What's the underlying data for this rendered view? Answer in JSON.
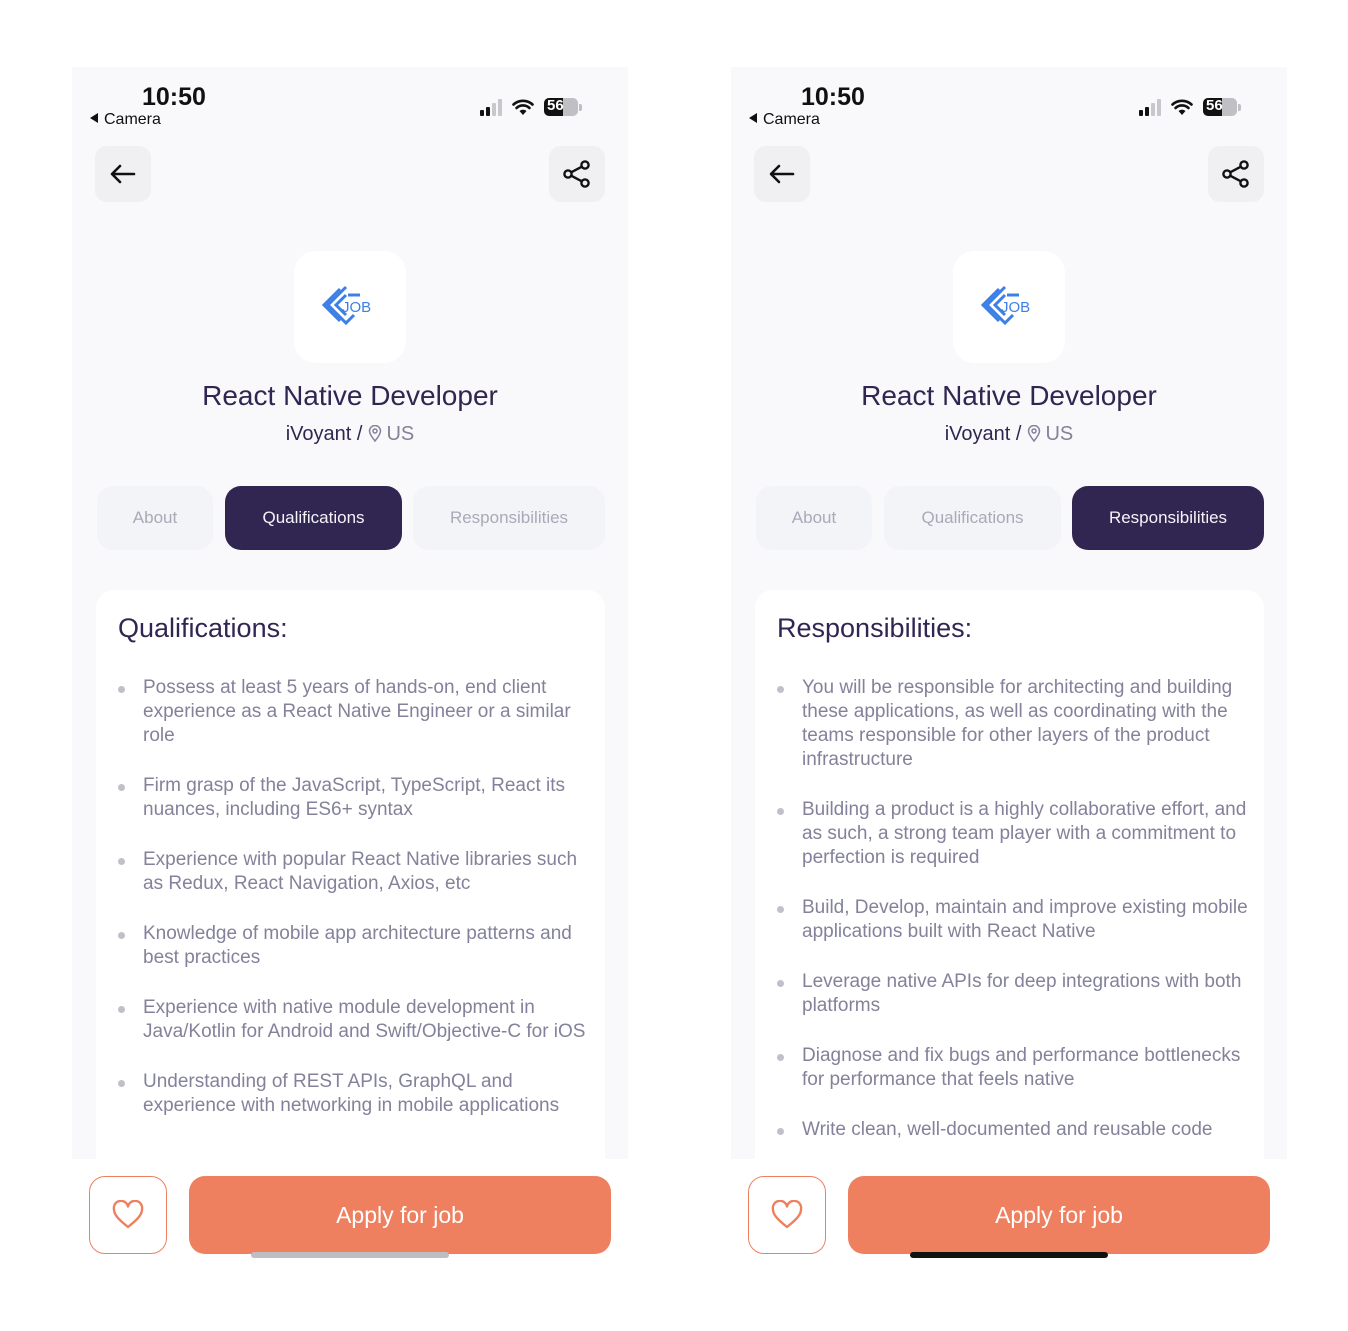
{
  "status_bar": {
    "time": "10:50",
    "back_app": "Camera",
    "battery": "56"
  },
  "job": {
    "title": "React Native Developer",
    "company": "iVoyant /",
    "location": "US",
    "logo_text": "JOB"
  },
  "tabs": [
    "About",
    "Qualifications",
    "Responsibilities"
  ],
  "left_screen": {
    "active_tab": "Qualifications",
    "section_title": "Qualifications:",
    "items": [
      "Possess at least 5 years of hands-on, end client experience as a React Native Engineer or a similar role",
      "Firm grasp of the JavaScript, TypeScript, React its nuances, including ES6+ syntax",
      "Experience with popular React Native libraries such as Redux, React Navigation, Axios, etc",
      "Knowledge of mobile app architecture patterns and best practices",
      "Experience with native module development in Java/Kotlin for Android and Swift/Objective-C for iOS",
      "Understanding of REST APIs, GraphQL and experience with networking in mobile applications"
    ]
  },
  "right_screen": {
    "active_tab": "Responsibilities",
    "section_title": "Responsibilities:",
    "items": [
      "You will be responsible for architecting and building these applications, as well as coordinating with the teams responsible for other layers of the product infrastructure",
      "Building a product is a highly collaborative effort, and as such, a strong team player with a commitment to perfection is required",
      "Build, Develop, maintain and improve existing mobile applications built with React Native",
      "Leverage native APIs for deep integrations with both platforms",
      "Diagnose and fix bugs and performance bottlenecks for performance that feels native",
      "Write clean, well-documented and reusable code"
    ]
  },
  "footer": {
    "apply_label": "Apply for job"
  },
  "icons": [
    "back-arrow-icon",
    "share-icon",
    "heart-icon",
    "location-pin-icon",
    "job-logo-icon",
    "signal-icon",
    "wifi-icon",
    "battery-icon"
  ],
  "colors": {
    "primary": "#312651",
    "accent": "#ee8060",
    "muted": "#83829a",
    "tab_bg": "#f3f4f8",
    "logo_blue": "#3c7fe6"
  }
}
